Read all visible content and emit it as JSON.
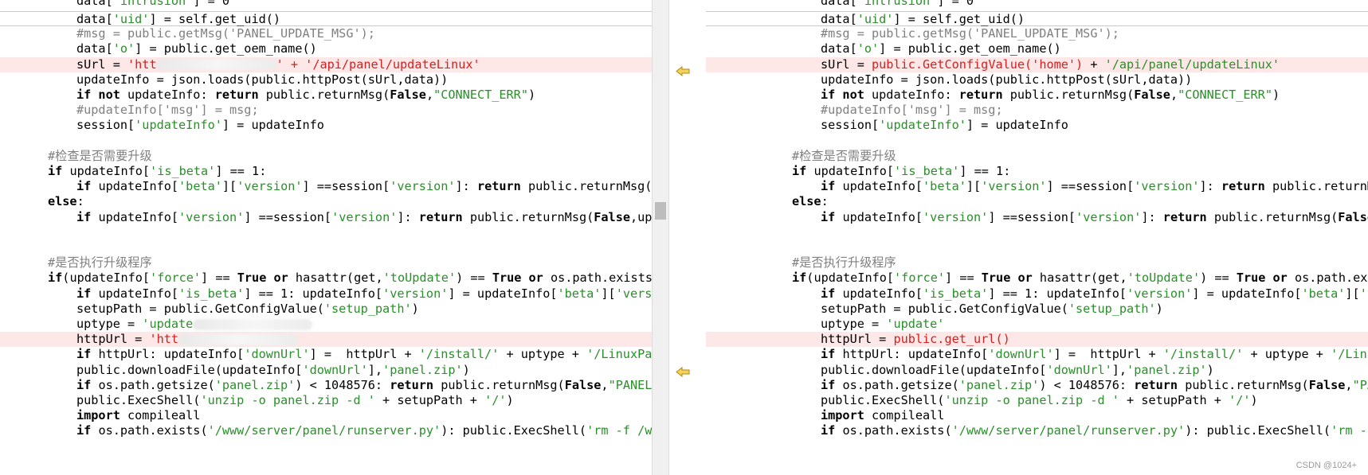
{
  "left_pane": {
    "lines": [
      {
        "indent": 96,
        "type": "current",
        "parts": [
          [
            "data[",
            ""
          ],
          [
            "'uid'",
            "str"
          ],
          [
            "] = self.get_uid()",
            ""
          ]
        ]
      },
      {
        "indent": 96,
        "parts": [
          [
            "#msg = public.getMsg('PANEL_UPDATE_MSG');",
            "cmt"
          ]
        ]
      },
      {
        "indent": 96,
        "parts": [
          [
            "data[",
            ""
          ],
          [
            "'o'",
            "str"
          ],
          [
            "] = public.get_oem_name()",
            ""
          ]
        ]
      },
      {
        "indent": 96,
        "type": "diff",
        "parts": [
          [
            "sUrl = ",
            ""
          ],
          [
            "'htt",
            "chg"
          ],
          [
            "",
            "blur"
          ],
          [
            "' + ",
            "chg"
          ],
          [
            "'/api/panel/updateLinux'",
            "chg"
          ]
        ]
      },
      {
        "indent": 96,
        "parts": [
          [
            "updateInfo = json.loads(public.httpPost(sUrl,data))",
            ""
          ]
        ]
      },
      {
        "indent": 96,
        "parts": [
          [
            "if not ",
            "kw"
          ],
          [
            "updateInfo: ",
            ""
          ],
          [
            "return ",
            "kw"
          ],
          [
            "public.returnMsg(",
            ""
          ],
          [
            "False",
            "kw"
          ],
          [
            ",",
            ""
          ],
          [
            "\"CONNECT_ERR\"",
            "str"
          ],
          [
            ")",
            ""
          ]
        ]
      },
      {
        "indent": 96,
        "parts": [
          [
            "#updateInfo['msg'] = msg;",
            "cmt"
          ]
        ]
      },
      {
        "indent": 96,
        "parts": [
          [
            "session[",
            ""
          ],
          [
            "'updateInfo'",
            "str"
          ],
          [
            "] = updateInfo",
            ""
          ]
        ]
      },
      {
        "indent": 60,
        "parts": []
      },
      {
        "indent": 60,
        "parts": [
          [
            "#检查是否需要升级",
            "cmt"
          ]
        ]
      },
      {
        "indent": 60,
        "parts": [
          [
            "if ",
            "kw"
          ],
          [
            "updateInfo[",
            ""
          ],
          [
            "'is_beta'",
            "str"
          ],
          [
            "] == 1:",
            ""
          ]
        ]
      },
      {
        "indent": 96,
        "parts": [
          [
            "if ",
            "kw"
          ],
          [
            "updateInfo[",
            ""
          ],
          [
            "'beta'",
            "str"
          ],
          [
            "][",
            ""
          ],
          [
            "'version'",
            "str"
          ],
          [
            "] ==session[",
            ""
          ],
          [
            "'version'",
            "str"
          ],
          [
            "]: ",
            ""
          ],
          [
            "return ",
            "kw"
          ],
          [
            "public.returnMsg(F",
            ""
          ]
        ]
      },
      {
        "indent": 60,
        "parts": [
          [
            "else",
            "kw"
          ],
          [
            ":",
            ""
          ]
        ]
      },
      {
        "indent": 96,
        "parts": [
          [
            "if ",
            "kw"
          ],
          [
            "updateInfo[",
            ""
          ],
          [
            "'version'",
            "str"
          ],
          [
            "] ==session[",
            ""
          ],
          [
            "'version'",
            "str"
          ],
          [
            "]: ",
            ""
          ],
          [
            "return ",
            "kw"
          ],
          [
            "public.returnMsg(",
            ""
          ],
          [
            "False",
            "kw"
          ],
          [
            ",upd",
            ""
          ]
        ]
      },
      {
        "indent": 60,
        "parts": []
      },
      {
        "indent": 60,
        "parts": []
      },
      {
        "indent": 60,
        "parts": [
          [
            "#是否执行升级程序",
            "cmt"
          ]
        ]
      },
      {
        "indent": 60,
        "parts": [
          [
            "if",
            "kw"
          ],
          [
            "(updateInfo[",
            ""
          ],
          [
            "'force'",
            "str"
          ],
          [
            "] == ",
            ""
          ],
          [
            "True ",
            "kw"
          ],
          [
            "or ",
            "kw"
          ],
          [
            "hasattr(get,",
            ""
          ],
          [
            "'toUpdate'",
            "str"
          ],
          [
            ") == ",
            ""
          ],
          [
            "True ",
            "kw"
          ],
          [
            "or ",
            "kw"
          ],
          [
            "os.path.exists(",
            ""
          ]
        ]
      },
      {
        "indent": 96,
        "parts": [
          [
            "if ",
            "kw"
          ],
          [
            "updateInfo[",
            ""
          ],
          [
            "'is_beta'",
            "str"
          ],
          [
            "] == 1: updateInfo[",
            ""
          ],
          [
            "'version'",
            "str"
          ],
          [
            "] = updateInfo[",
            ""
          ],
          [
            "'beta'",
            "str"
          ],
          [
            "][",
            ""
          ],
          [
            "'versi",
            "str"
          ]
        ]
      },
      {
        "indent": 96,
        "parts": [
          [
            "setupPath = public.GetConfigValue(",
            ""
          ],
          [
            "'setup_path'",
            "str"
          ],
          [
            ")",
            ""
          ]
        ]
      },
      {
        "indent": 96,
        "parts": [
          [
            "uptype = ",
            ""
          ],
          [
            "'update",
            "str"
          ],
          [
            "",
            "blur"
          ]
        ]
      },
      {
        "indent": 96,
        "type": "diff",
        "parts": [
          [
            "httpUrl = ",
            ""
          ],
          [
            "'htt",
            "chg"
          ],
          [
            "",
            "blur"
          ]
        ]
      },
      {
        "indent": 96,
        "parts": [
          [
            "if ",
            "kw"
          ],
          [
            "httpUrl: updateInfo[",
            ""
          ],
          [
            "'downUrl'",
            "str"
          ],
          [
            "] =  httpUrl + ",
            ""
          ],
          [
            "'/install/'",
            "str"
          ],
          [
            " + uptype + ",
            ""
          ],
          [
            "'/LinuxPan",
            "str"
          ]
        ]
      },
      {
        "indent": 96,
        "parts": [
          [
            "public.downloadFile(updateInfo[",
            ""
          ],
          [
            "'downUrl'",
            "str"
          ],
          [
            "],",
            ""
          ],
          [
            "'panel.zip'",
            "str"
          ],
          [
            ")",
            ""
          ]
        ]
      },
      {
        "indent": 96,
        "parts": [
          [
            "if ",
            "kw"
          ],
          [
            "os.path.getsize(",
            ""
          ],
          [
            "'panel.zip'",
            "str"
          ],
          [
            ") < 1048576: ",
            ""
          ],
          [
            "return ",
            "kw"
          ],
          [
            "public.returnMsg(",
            ""
          ],
          [
            "False",
            "kw"
          ],
          [
            ",",
            ""
          ],
          [
            "\"PANEL_",
            "str"
          ]
        ]
      },
      {
        "indent": 96,
        "parts": [
          [
            "public.ExecShell(",
            ""
          ],
          [
            "'unzip -o panel.zip -d '",
            "str"
          ],
          [
            " + setupPath + ",
            ""
          ],
          [
            "'/'",
            "str"
          ],
          [
            ")",
            ""
          ]
        ]
      },
      {
        "indent": 96,
        "parts": [
          [
            "import ",
            "kw"
          ],
          [
            "compileall",
            ""
          ]
        ]
      },
      {
        "indent": 96,
        "parts": [
          [
            "if ",
            "kw"
          ],
          [
            "os.path.exists(",
            ""
          ],
          [
            "'/www/server/panel/runserver.py'",
            "str"
          ],
          [
            "): public.ExecShell(",
            ""
          ],
          [
            "'rm -f /ww",
            "str"
          ]
        ]
      }
    ]
  },
  "right_pane": {
    "lines": [
      {
        "indent": 144,
        "type": "current",
        "parts": [
          [
            "data[",
            ""
          ],
          [
            "'uid'",
            "str"
          ],
          [
            "] = self.get_uid()",
            ""
          ]
        ]
      },
      {
        "indent": 144,
        "parts": [
          [
            "#msg = public.getMsg('PANEL_UPDATE_MSG');",
            "cmt"
          ]
        ]
      },
      {
        "indent": 144,
        "parts": [
          [
            "data[",
            ""
          ],
          [
            "'o'",
            "str"
          ],
          [
            "] = public.get_oem_name()",
            ""
          ]
        ]
      },
      {
        "indent": 144,
        "type": "diff",
        "parts": [
          [
            "sUrl = ",
            ""
          ],
          [
            "public.GetConfigValue('home')",
            "chg"
          ],
          [
            " + ",
            ""
          ],
          [
            "'/api/panel/updateLinux'",
            "str"
          ]
        ]
      },
      {
        "indent": 144,
        "parts": [
          [
            "updateInfo = json.loads(public.httpPost(sUrl,data))",
            ""
          ]
        ]
      },
      {
        "indent": 144,
        "parts": [
          [
            "if not ",
            "kw"
          ],
          [
            "updateInfo: ",
            ""
          ],
          [
            "return ",
            "kw"
          ],
          [
            "public.returnMsg(",
            ""
          ],
          [
            "False",
            "kw"
          ],
          [
            ",",
            ""
          ],
          [
            "\"CONNECT_ERR\"",
            "str"
          ],
          [
            ")",
            ""
          ]
        ]
      },
      {
        "indent": 144,
        "parts": [
          [
            "#updateInfo['msg'] = msg;",
            "cmt"
          ]
        ]
      },
      {
        "indent": 144,
        "parts": [
          [
            "session[",
            ""
          ],
          [
            "'updateInfo'",
            "str"
          ],
          [
            "] = updateInfo",
            ""
          ]
        ]
      },
      {
        "indent": 108,
        "parts": []
      },
      {
        "indent": 108,
        "parts": [
          [
            "#检查是否需要升级",
            "cmt"
          ]
        ]
      },
      {
        "indent": 108,
        "parts": [
          [
            "if ",
            "kw"
          ],
          [
            "updateInfo[",
            ""
          ],
          [
            "'is_beta'",
            "str"
          ],
          [
            "] == 1:",
            ""
          ]
        ]
      },
      {
        "indent": 144,
        "parts": [
          [
            "if ",
            "kw"
          ],
          [
            "updateInfo[",
            ""
          ],
          [
            "'beta'",
            "str"
          ],
          [
            "][",
            ""
          ],
          [
            "'version'",
            "str"
          ],
          [
            "] ==session[",
            ""
          ],
          [
            "'version'",
            "str"
          ],
          [
            "]: ",
            ""
          ],
          [
            "return ",
            "kw"
          ],
          [
            "public.returnMs",
            ""
          ]
        ]
      },
      {
        "indent": 108,
        "parts": [
          [
            "else",
            "kw"
          ],
          [
            ":",
            ""
          ]
        ]
      },
      {
        "indent": 144,
        "parts": [
          [
            "if ",
            "kw"
          ],
          [
            "updateInfo[",
            ""
          ],
          [
            "'version'",
            "str"
          ],
          [
            "] ==session[",
            ""
          ],
          [
            "'version'",
            "str"
          ],
          [
            "]: ",
            ""
          ],
          [
            "return ",
            "kw"
          ],
          [
            "public.returnMsg(",
            ""
          ],
          [
            "False,",
            "kw"
          ]
        ]
      },
      {
        "indent": 108,
        "parts": []
      },
      {
        "indent": 108,
        "parts": []
      },
      {
        "indent": 108,
        "parts": [
          [
            "#是否执行升级程序",
            "cmt"
          ]
        ]
      },
      {
        "indent": 108,
        "parts": [
          [
            "if",
            "kw"
          ],
          [
            "(updateInfo[",
            ""
          ],
          [
            "'force'",
            "str"
          ],
          [
            "] == ",
            ""
          ],
          [
            "True ",
            "kw"
          ],
          [
            "or ",
            "kw"
          ],
          [
            "hasattr(get,",
            ""
          ],
          [
            "'toUpdate'",
            "str"
          ],
          [
            ") == ",
            ""
          ],
          [
            "True ",
            "kw"
          ],
          [
            "or ",
            "kw"
          ],
          [
            "os.path.exis",
            ""
          ]
        ]
      },
      {
        "indent": 144,
        "parts": [
          [
            "if ",
            "kw"
          ],
          [
            "updateInfo[",
            ""
          ],
          [
            "'is_beta'",
            "str"
          ],
          [
            "] == 1: updateInfo[",
            ""
          ],
          [
            "'version'",
            "str"
          ],
          [
            "] = updateInfo[",
            ""
          ],
          [
            "'beta'",
            "str"
          ],
          [
            "][",
            ""
          ],
          [
            "'v",
            "str"
          ]
        ]
      },
      {
        "indent": 144,
        "parts": [
          [
            "setupPath = public.GetConfigValue(",
            ""
          ],
          [
            "'setup_path'",
            "str"
          ],
          [
            ")",
            ""
          ]
        ]
      },
      {
        "indent": 144,
        "parts": [
          [
            "uptype = ",
            ""
          ],
          [
            "'update'",
            "str"
          ]
        ]
      },
      {
        "indent": 144,
        "type": "diff",
        "parts": [
          [
            "httpUrl = ",
            ""
          ],
          [
            "public.get_url()",
            "chg"
          ]
        ]
      },
      {
        "indent": 144,
        "parts": [
          [
            "if ",
            "kw"
          ],
          [
            "httpUrl: updateInfo[",
            ""
          ],
          [
            "'downUrl'",
            "str"
          ],
          [
            "] =  httpUrl + ",
            ""
          ],
          [
            "'/install/'",
            "str"
          ],
          [
            " + uptype + ",
            ""
          ],
          [
            "'/Linux",
            "str"
          ]
        ]
      },
      {
        "indent": 144,
        "parts": [
          [
            "public.downloadFile(updateInfo[",
            ""
          ],
          [
            "'downUrl'",
            "str"
          ],
          [
            "],",
            ""
          ],
          [
            "'panel.zip'",
            "str"
          ],
          [
            ")",
            ""
          ]
        ]
      },
      {
        "indent": 144,
        "parts": [
          [
            "if ",
            "kw"
          ],
          [
            "os.path.getsize(",
            ""
          ],
          [
            "'panel.zip'",
            "str"
          ],
          [
            ") < 1048576: ",
            ""
          ],
          [
            "return ",
            "kw"
          ],
          [
            "public.returnMsg(",
            ""
          ],
          [
            "False",
            "kw"
          ],
          [
            ",",
            ""
          ],
          [
            "\"PAN",
            "str"
          ]
        ]
      },
      {
        "indent": 144,
        "parts": [
          [
            "public.ExecShell(",
            ""
          ],
          [
            "'unzip -o panel.zip -d '",
            "str"
          ],
          [
            " + setupPath + ",
            ""
          ],
          [
            "'/'",
            "str"
          ],
          [
            ")",
            ""
          ]
        ]
      },
      {
        "indent": 144,
        "parts": [
          [
            "import ",
            "kw"
          ],
          [
            "compileall",
            ""
          ]
        ]
      },
      {
        "indent": 144,
        "parts": [
          [
            "if ",
            "kw"
          ],
          [
            "os.path.exists(",
            ""
          ],
          [
            "'/www/server/panel/runserver.py'",
            "str"
          ],
          [
            "): public.ExecShell(",
            ""
          ],
          [
            "'rm -f",
            "str"
          ]
        ]
      }
    ]
  },
  "top_partial": {
    "left": [
      [
        "data[",
        ""
      ],
      [
        "'intrusion'",
        "str"
      ],
      [
        "] = 0",
        ""
      ]
    ],
    "right": [
      [
        "data[",
        ""
      ],
      [
        "'intrusion'",
        "str"
      ],
      [
        "] = 0",
        ""
      ]
    ]
  },
  "watermark": "CSDN @1024+",
  "colors": {
    "diff_bg": "#fde7e7",
    "changed_text": "#d42020",
    "string": "#2a8f2a",
    "comment": "#808080"
  }
}
